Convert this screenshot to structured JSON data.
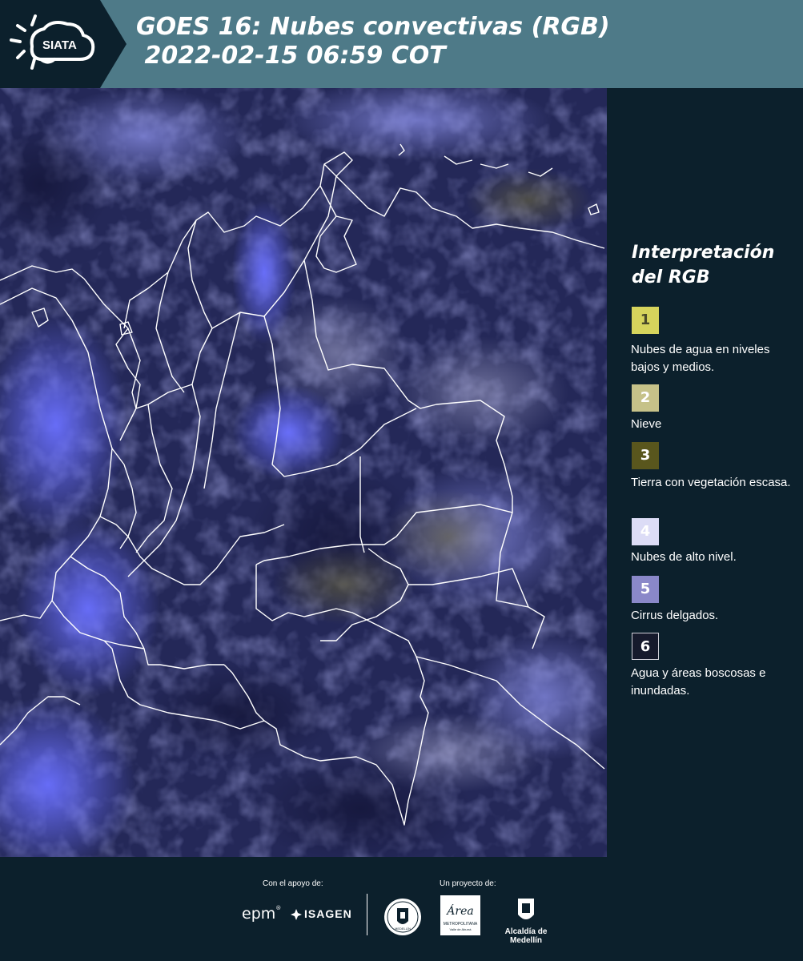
{
  "header": {
    "title_line1": "GOES 16: Nubes convectivas (RGB)",
    "title_line2": " 2022-02-15 06:59 COT",
    "logo_text": "SIATA",
    "logo_icon": "sun-cloud-icon"
  },
  "map": {
    "content": "satellite-rgb-image",
    "colors": {
      "background": "#23285e",
      "cloud": "#5d63d8",
      "yellow_clouds": "#8a8a6a",
      "borders": "#ffffff"
    }
  },
  "legend": {
    "title": "Interpretación del RGB",
    "items": [
      {
        "number": "1",
        "color": "#d6d45c",
        "text_color": "#4a4a2a",
        "label": "Nubes de agua en niveles bajos y medios."
      },
      {
        "number": "2",
        "color": "#c6c289",
        "text_color": "#ffffff",
        "label": "Nieve"
      },
      {
        "number": "3",
        "color": "#59561d",
        "text_color": "#ffffff",
        "label": "Tierra con vegetación escasa."
      },
      {
        "number": "4",
        "color": "#dcdcf6",
        "text_color": "#ffffff",
        "label": "Nubes de alto nivel."
      },
      {
        "number": "5",
        "color": "#8a88c9",
        "text_color": "#ffffff",
        "label": "Cirrus delgados."
      },
      {
        "number": "6",
        "color": "#161a2c",
        "text_color": "#ffffff",
        "label": "Agua y áreas boscosas e inundadas."
      }
    ]
  },
  "footer": {
    "support_caption": "Con el apoyo de:",
    "project_caption": "Un proyecto de:",
    "sponsors": [
      "epm",
      "ISAGEN"
    ],
    "partners": {
      "medellin_seal": "MEDELLÍN",
      "area_logo": "Área",
      "area_sub1": "METROPOLITANA",
      "area_sub2": "Valle de Aburrá",
      "alcaldia": "Alcaldía de Medellín"
    }
  }
}
